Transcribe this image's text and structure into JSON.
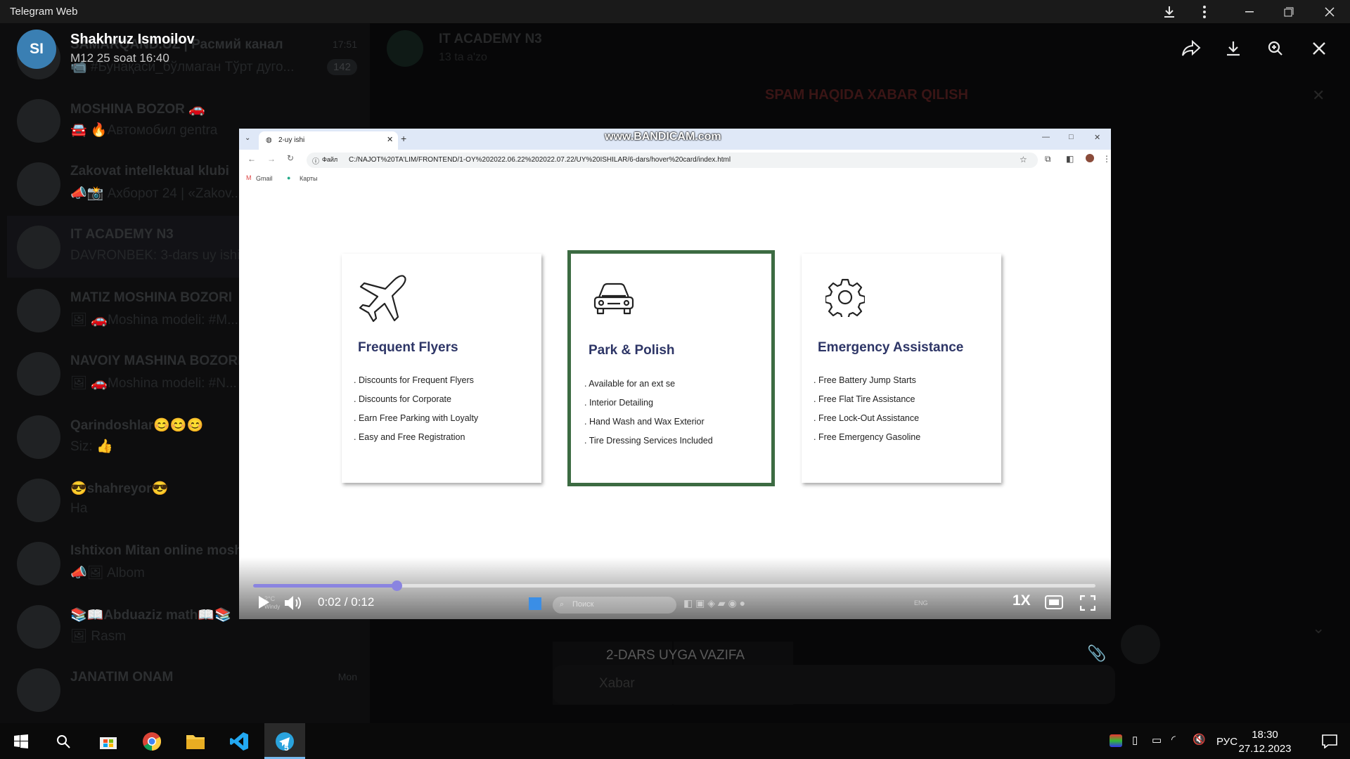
{
  "window": {
    "title": "Telegram Web"
  },
  "viewer": {
    "sender_initials": "SI",
    "sender_name": "Shakhruz Ismoilov",
    "date": "M12 25 soat 16:40"
  },
  "background_chat": {
    "title": "IT ACADEMY N3",
    "members": "13 ta a'zo",
    "spam_banner": "SPAM HAQIDA XABAR QILISH",
    "caption": "2-DARS UYGA VAZIFA",
    "compose_placeholder": "Xabar"
  },
  "chat_list": [
    {
      "name": "SAMARQAND.UZ | Расмий канал",
      "message": "📹 #Бунақаси_бўлмаган Тўрт дуго...",
      "time": "17:51",
      "badge": "142"
    },
    {
      "name": "MOSHINA BOZOR 🚗",
      "message": "🚘 🔥Автомобил gentra",
      "time": "",
      "badge": ""
    },
    {
      "name": "Zakovat intellektual klubi",
      "message": "📣📸 Ахборот 24 | «Zakov...",
      "time": "",
      "badge": ""
    },
    {
      "name": "IT ACADEMY N3",
      "message": "DAVRONBEK: 3-dars uy ishi",
      "time": "",
      "badge": ""
    },
    {
      "name": "MATIZ MOSHINA BOZORI",
      "message": "🖼 🚗Moshina modeli: #M...",
      "time": "",
      "badge": ""
    },
    {
      "name": "NAVOIY MASHINA BOZORI",
      "message": "🖼 🚗Moshina modeli: #N...",
      "time": "",
      "badge": ""
    },
    {
      "name": "Qarindoshlar😊😊😊",
      "message": "Siz: 👍",
      "time": "",
      "badge": ""
    },
    {
      "name": "😎shahreyor😎",
      "message": "Ha",
      "time": "",
      "badge": ""
    },
    {
      "name": "Ishtixon Mitan online mosh...",
      "message": "📣🖼 Albom",
      "time": "",
      "badge": ""
    },
    {
      "name": "📚📖Abduaziz math📖📚",
      "message": "🖼 Rasm",
      "time": "Mon",
      "badge": ""
    },
    {
      "name": "JANATIM ONAM",
      "message": "",
      "time": "Mon",
      "badge": ""
    }
  ],
  "video": {
    "browser": {
      "tab_title": "2-uy ishi",
      "watermark": "www.BANDICAM.com",
      "file_label": "Файл",
      "url": "C:/NAJOT%20TA'LIM/FRONTEND/1-OY%202022.06.22%202022.07.22/UY%20ISHILAR/6-dars/hover%20card/index.html",
      "bookmarks": [
        "Gmail",
        "Карты"
      ]
    },
    "cards": [
      {
        "title": "Frequent Flyers",
        "icon": "airplane-icon",
        "items": [
          ". Discounts for Frequent Flyers",
          ". Discounts for Corporate",
          ". Earn Free Parking with Loyalty",
          ". Easy and Free Registration"
        ],
        "active": false
      },
      {
        "title": "Park & Polish",
        "icon": "car-icon",
        "items": [
          ". Available for an ext   se",
          ". Interior Detailing",
          ". Hand Wash and Wax Exterior",
          ". Tire Dressing Services Included"
        ],
        "active": true
      },
      {
        "title": "Emergency Assistance",
        "icon": "gear-icon",
        "items": [
          ". Free Battery Jump Starts",
          ". Free Flat Tire Assistance",
          ". Free Lock-Out Assistance",
          ". Free Emergency Gasoline"
        ],
        "active": false
      }
    ],
    "player": {
      "time": "0:02 / 0:12",
      "progress": 0.17,
      "speed": "1X",
      "weather": "2°C",
      "weather_desc": "Windy",
      "inner_search": "Поиск",
      "inner_lang": "ENG"
    }
  },
  "taskbar": {
    "lang": "РУС",
    "time": "18:30",
    "date": "27.12.2023",
    "telegram_badge": "5"
  },
  "colors": {
    "accent": "#8a84e0",
    "card_border": "#3c6b42",
    "card_title": "#2d3566",
    "avatar": "#3a7fb3"
  }
}
